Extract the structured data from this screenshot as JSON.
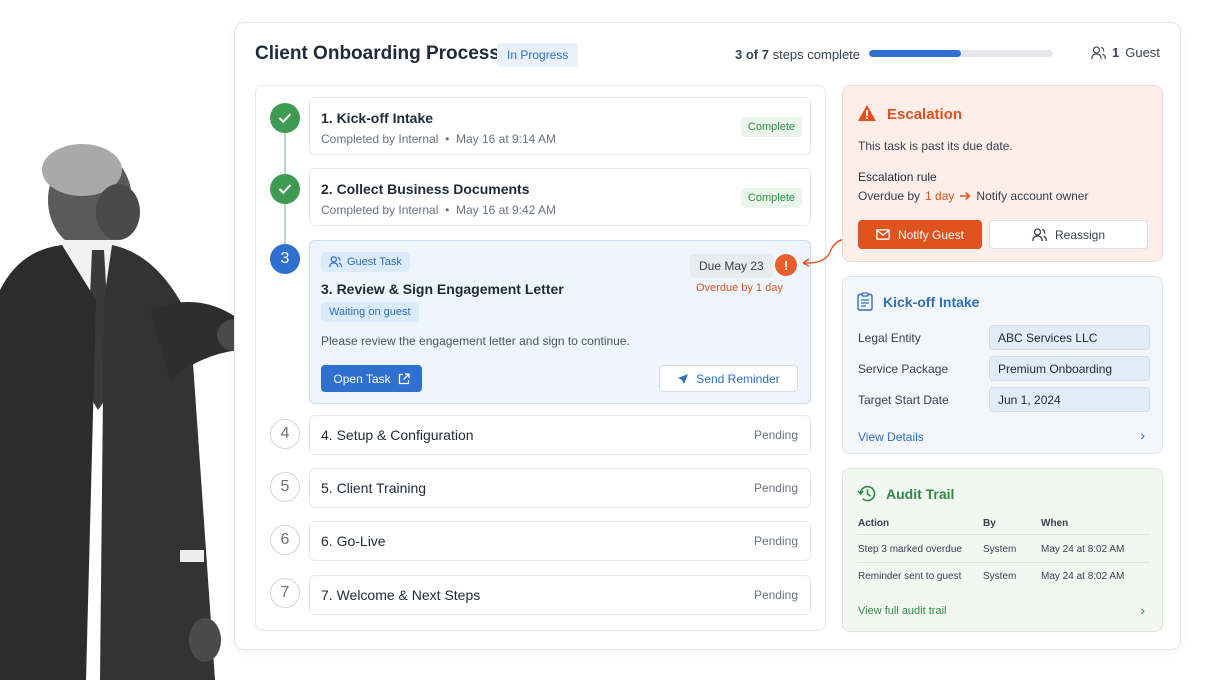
{
  "header": {
    "title": "Client Onboarding Process",
    "status": "In Progress",
    "progress_count": "3 of 7",
    "progress_suffix": " steps complete",
    "progress_fraction": 0.5,
    "guest_count": "1",
    "guest_label": "Guest"
  },
  "steps": [
    {
      "marker": "check",
      "title": "1. Kick-off Intake",
      "completed_by": "Completed by Internal",
      "sep": "•",
      "timestamp": "May 16 at 9:14 AM",
      "status": "Complete"
    },
    {
      "marker": "check",
      "title": "2. Collect Business Documents",
      "completed_by": "Completed by Internal",
      "sep": "•",
      "timestamp": "May 16 at 9:42 AM",
      "status": "Complete"
    },
    {
      "marker": "3",
      "tag": "Guest Task",
      "title": "3. Review & Sign Engagement Letter",
      "waiting": "Waiting on guest",
      "description": "Please review the engagement letter and sign to continue.",
      "due": "Due May 23",
      "alert": "!",
      "overdue": "Overdue by 1 day",
      "open_label": "Open Task",
      "reminder_label": "Send Reminder"
    },
    {
      "marker": "4",
      "title": "4. Setup & Configuration",
      "status": "Pending"
    },
    {
      "marker": "5",
      "title": "5. Client Training",
      "status": "Pending"
    },
    {
      "marker": "6",
      "title": "6. Go-Live",
      "status": "Pending"
    },
    {
      "marker": "7",
      "title": "7. Welcome & Next Steps",
      "status": "Pending"
    }
  ],
  "escalation": {
    "title": "Escalation",
    "message": "This task is past its due date.",
    "rule_label": "Escalation rule",
    "rule_prefix": "Overdue by",
    "rule_value": "1 day",
    "rule_action": "Notify account owner",
    "notify_label": "Notify Guest",
    "reassign_label": "Reassign"
  },
  "intake": {
    "title": "Kick-off Intake",
    "fields": [
      {
        "label": "Legal Entity",
        "value": "ABC Services LLC"
      },
      {
        "label": "Service Package",
        "value": "Premium Onboarding"
      },
      {
        "label": "Target Start Date",
        "value": "Jun 1, 2024"
      }
    ],
    "link": "View Details"
  },
  "audit": {
    "title": "Audit Trail",
    "columns": [
      "Action",
      "By",
      "When"
    ],
    "rows": [
      [
        "Step 3 marked overdue",
        "System",
        "May 24 at 8:02 AM"
      ],
      [
        "Reminder sent to guest",
        "System",
        "May 24 at 8:02 AM"
      ]
    ],
    "link": "View full audit trail"
  },
  "colors": {
    "accent": "#2f6fd0",
    "success": "#3f9a52",
    "danger": "#e0531f"
  }
}
